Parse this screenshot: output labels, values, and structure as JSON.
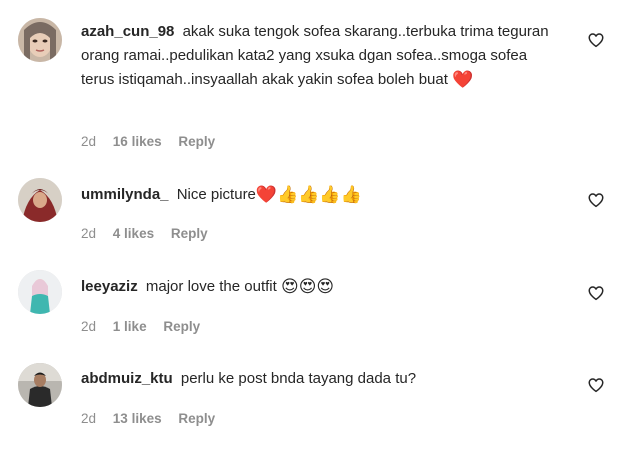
{
  "comments": [
    {
      "username": "azah_cun_98",
      "text": "akak suka tengok sofea skarang..terbuka trima teguran orang ramai..pedulikan kata2 yang xsuka dgan sofea..smoga sofea terus istiqamah..insyaallah akak yakin sofea boleh buat",
      "emoji": "❤️",
      "time": "2d",
      "likes": "16 likes",
      "reply": "Reply"
    },
    {
      "username": "ummilynda_",
      "text": "Nice picture",
      "emoji": "❤️👍👍👍👍",
      "time": "2d",
      "likes": "4 likes",
      "reply": "Reply"
    },
    {
      "username": "leeyaziz",
      "text": "major love the outfit",
      "emoji": "😍😍😍",
      "time": "2d",
      "likes": "1 like",
      "reply": "Reply"
    },
    {
      "username": "abdmuiz_ktu",
      "text": "perlu ke post bnda tayang dada tu?",
      "emoji": "",
      "time": "2d",
      "likes": "13 likes",
      "reply": "Reply"
    }
  ],
  "icons": {
    "like": "heart-outline-icon"
  },
  "colors": {
    "text": "#262626",
    "muted": "#8e8e8e"
  }
}
